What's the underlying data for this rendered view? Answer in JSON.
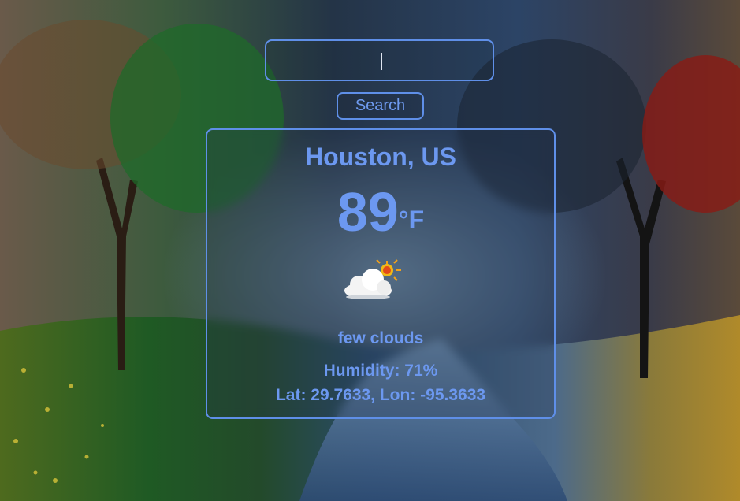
{
  "search": {
    "value": "",
    "button_label": "Search"
  },
  "weather": {
    "city": "Houston, US",
    "temperature": "89",
    "unit": "°F",
    "condition_icon": "few-clouds-day-icon",
    "description": "few clouds",
    "humidity_text": "Humidity: 71%",
    "coords_text": "Lat: 29.7633, Lon: -95.3633"
  },
  "colors": {
    "accent": "#5f8fe8",
    "text": "#6c98f0"
  }
}
